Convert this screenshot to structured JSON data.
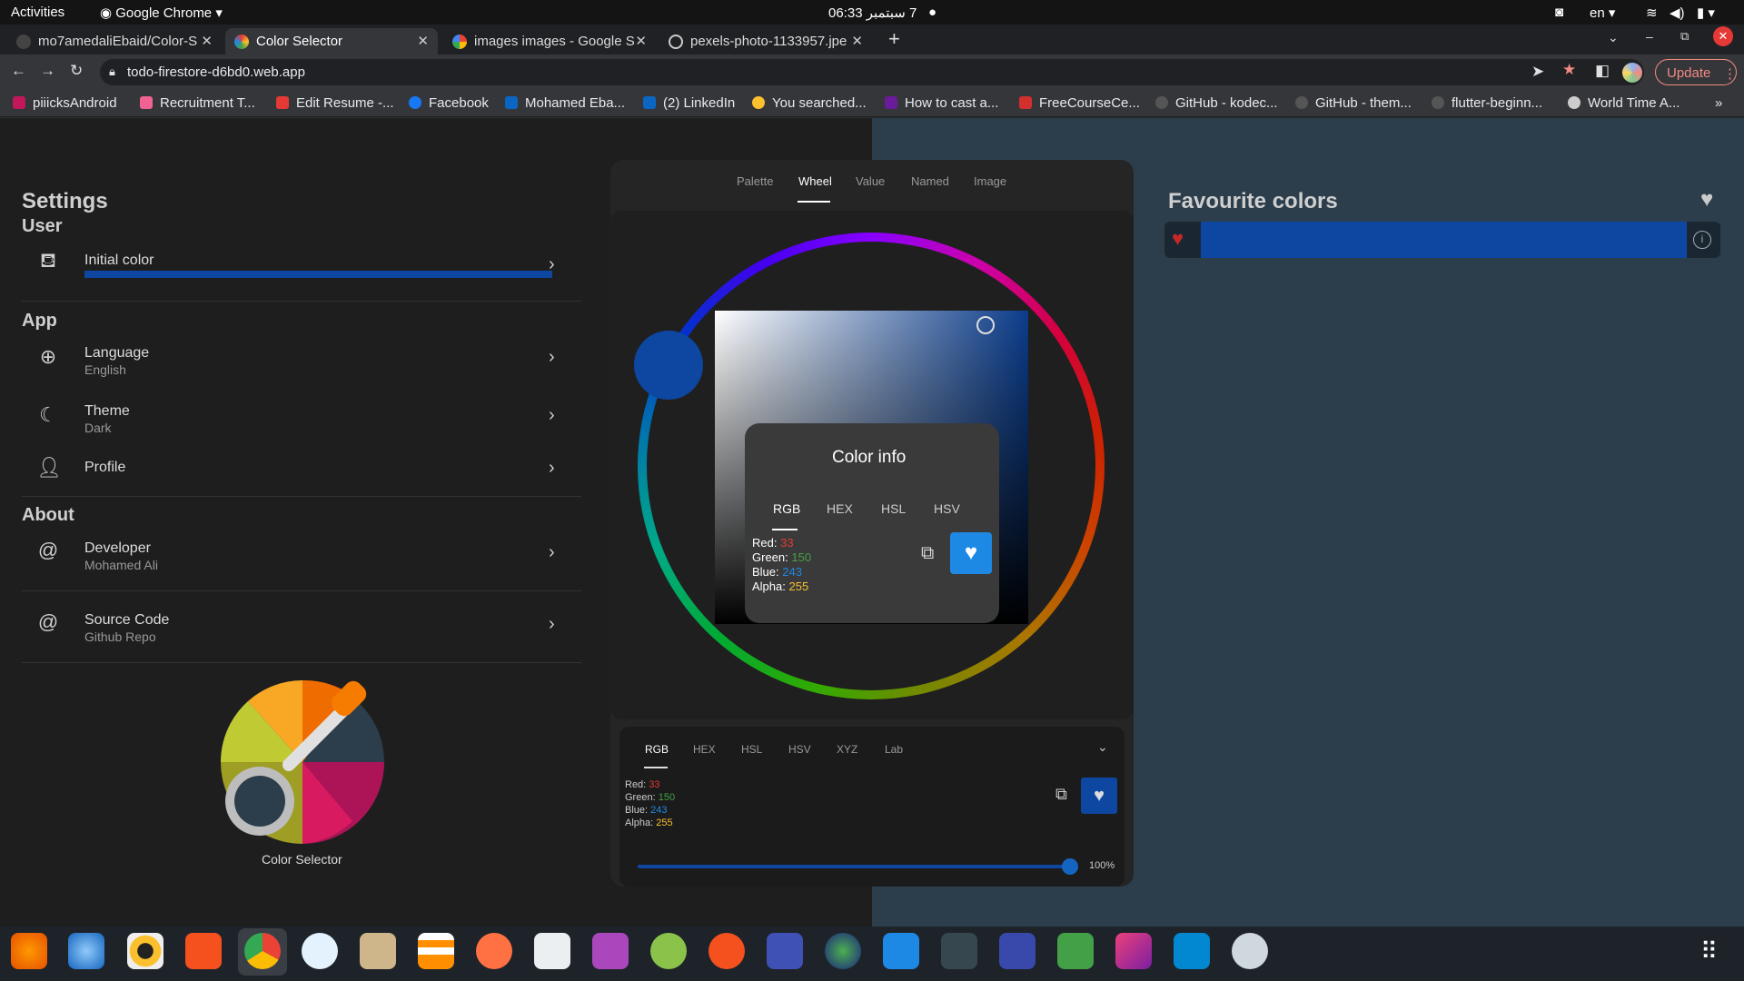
{
  "system": {
    "activities": "Activities",
    "app_name": "Google Chrome",
    "clock": "06:33 ‏7 سبتمبر",
    "lang": "en"
  },
  "tabs": [
    {
      "label": "mo7amedaliEbaid/Color-S"
    },
    {
      "label": "Color Selector"
    },
    {
      "label": "images images - Google S"
    },
    {
      "label": "pexels-photo-1133957.jpe"
    }
  ],
  "toolbar": {
    "url": "todo-firestore-d6bd0.web.app",
    "update_label": "Update"
  },
  "bookmarks": [
    "piiicksAndroid",
    "Recruitment T...",
    "Edit Resume -...",
    "Facebook",
    "Mohamed Eba...",
    "(2) LinkedIn",
    "You searched...",
    "How to cast a...",
    "FreeCourseCe...",
    "GitHub - kodec...",
    "GitHub - them...",
    "flutter-beginn...",
    "World Time A..."
  ],
  "settings": {
    "title": "Settings",
    "user_section": "User",
    "initial_color": "Initial color",
    "app_section": "App",
    "language": "Language",
    "language_value": "English",
    "theme": "Theme",
    "theme_value": "Dark",
    "profile": "Profile",
    "about_section": "About",
    "developer": "Developer",
    "developer_value": "Mohamed Ali",
    "source": "Source Code",
    "source_value": "Github Repo",
    "logo_caption": "Color Selector"
  },
  "picker": {
    "tabs": [
      "Palette",
      "Wheel",
      "Value",
      "Named",
      "Image"
    ],
    "selected_color": "#0050a0"
  },
  "dialog": {
    "title": "Color info",
    "tabs": [
      "RGB",
      "HEX",
      "HSL",
      "HSV"
    ],
    "red_label": "Red:",
    "red": "33",
    "green_label": "Green:",
    "green": "150",
    "blue_label": "Blue:",
    "blue": "243",
    "alpha_label": "Alpha:",
    "alpha": "255"
  },
  "bottom_panel": {
    "tabs": [
      "RGB",
      "HEX",
      "HSL",
      "HSV",
      "XYZ",
      "Lab"
    ],
    "opacity": "100%"
  },
  "favourites": {
    "title": "Favourite colors",
    "color": "#0d47a1"
  },
  "colors": {
    "accent_blue": "#1e88e5",
    "red_value": "#e53935",
    "green_value": "#43a047",
    "blue_value": "#1e88e5",
    "alpha_value": "#fbc02d"
  }
}
